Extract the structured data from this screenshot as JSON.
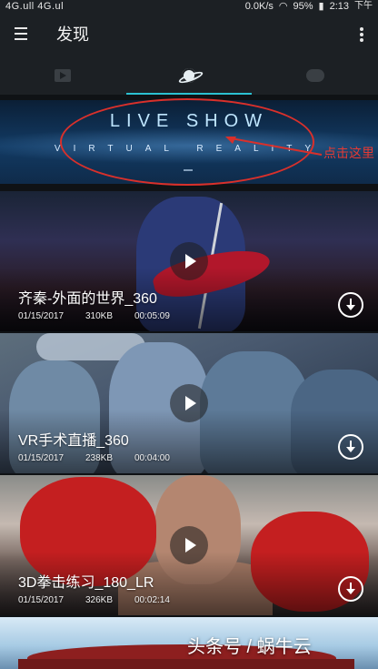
{
  "status_bar": {
    "left_text": "4G.ull 4G.ul",
    "network_speed": "0.0K/s",
    "battery": "95%",
    "time": "2:13",
    "ampm": "下午"
  },
  "app_bar": {
    "title": "发现"
  },
  "tabs": [
    {
      "icon": "film-icon"
    },
    {
      "icon": "planet-icon"
    },
    {
      "icon": "cloud-icon"
    }
  ],
  "banner": {
    "title": "LIVE SHOW",
    "subtitle": "VIRTUAL  REALITY",
    "annotation": "点击这里"
  },
  "videos": [
    {
      "title": "齐秦-外面的世界_360",
      "date": "01/15/2017",
      "size": "310KB",
      "duration": "00:05:09"
    },
    {
      "title": "VR手术直播_360",
      "date": "01/15/2017",
      "size": "238KB",
      "duration": "00:04:00"
    },
    {
      "title": "3D拳击练习_180_LR",
      "date": "01/15/2017",
      "size": "326KB",
      "duration": "00:02:14"
    }
  ],
  "watermark": "头条号 / 蜗牛云",
  "colors": {
    "accent": "#2bc0d1",
    "annotation": "#e43a34",
    "app_bar": "#1c2024"
  }
}
